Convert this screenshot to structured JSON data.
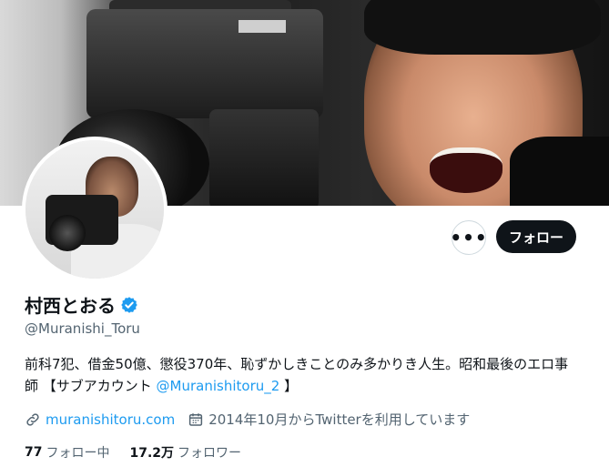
{
  "profile": {
    "name": "村西とおる",
    "handle": "@Muranishi_Toru",
    "bio_text": "前科7犯、借金50億、懲役370年、恥ずかしきことのみ多かりき人生。昭和最後のエロ事師 【サブアカウント ",
    "bio_mention": "@Muranishitoru_2",
    "bio_end": " 】",
    "website": "muranishitoru.com",
    "joined": "2014年10月からTwitterを利用しています",
    "following_count": "77",
    "following_label": "フォロー中",
    "followers_count": "17.2万",
    "followers_label": "フォロワー"
  },
  "actions": {
    "more_label": "•••",
    "follow_label": "フォロー"
  },
  "icons": {
    "verified": "verified-badge-icon",
    "link": "link-icon",
    "calendar": "calendar-icon",
    "more": "more-icon"
  },
  "colors": {
    "accent": "#1d9bf0",
    "text": "#0f1419",
    "secondary": "#536471",
    "button_dark": "#0f1419"
  }
}
